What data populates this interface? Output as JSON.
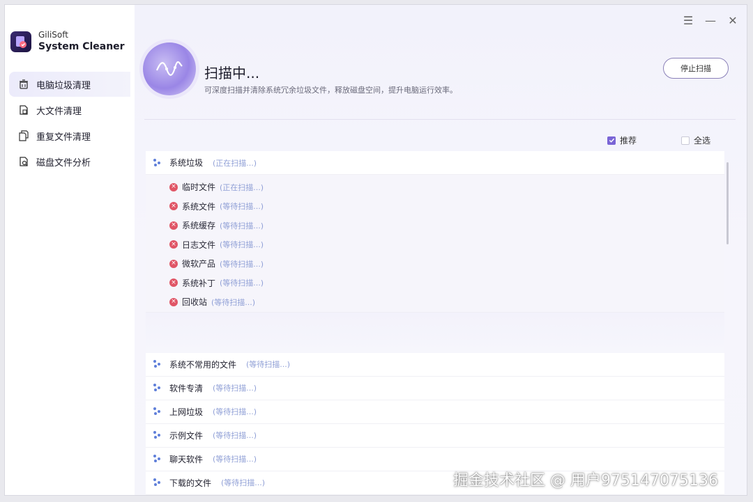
{
  "app": {
    "brand_small": "GiliSoft",
    "brand_name": "System Cleaner"
  },
  "sidebar": {
    "items": [
      {
        "label": "电脑垃圾清理",
        "icon": "trash-icon",
        "active": true
      },
      {
        "label": "大文件清理",
        "icon": "large-file-icon",
        "active": false
      },
      {
        "label": "重复文件清理",
        "icon": "duplicate-file-icon",
        "active": false
      },
      {
        "label": "磁盘文件分析",
        "icon": "disk-analysis-icon",
        "active": false
      }
    ]
  },
  "window_controls": {
    "menu": "☰",
    "minimize": "—",
    "close": "✕"
  },
  "header": {
    "title": "扫描中...",
    "subtitle": "可深度扫描并清除系统冗余垃圾文件，释放磁盘空间，提升电脑运行效率。",
    "stop_button": "停止扫描"
  },
  "filters": {
    "recommended": "推荐",
    "recommended_checked": true,
    "select_all": "全选",
    "select_all_checked": false
  },
  "groups": [
    {
      "label": "系统垃圾",
      "status": "(正在扫描...)",
      "children": [
        {
          "label": "临时文件",
          "status": "(正在扫描...)"
        },
        {
          "label": "系统文件",
          "status": "(等待扫描...)"
        },
        {
          "label": "系统缓存",
          "status": "(等待扫描...)"
        },
        {
          "label": "日志文件",
          "status": "(等待扫描...)"
        },
        {
          "label": "微软产品",
          "status": "(等待扫描...)"
        },
        {
          "label": "系统补丁",
          "status": "(等待扫描...)"
        },
        {
          "label": "回收站",
          "status": "(等待扫描...)"
        }
      ]
    },
    {
      "label": "系统不常用的文件",
      "status": "(等待扫描...)"
    },
    {
      "label": "软件专清",
      "status": "(等待扫描...)"
    },
    {
      "label": "上网垃圾",
      "status": "(等待扫描...)"
    },
    {
      "label": "示例文件",
      "status": "(等待扫描...)"
    },
    {
      "label": "聊天软件",
      "status": "(等待扫描...)"
    },
    {
      "label": "下载的文件",
      "status": "(等待扫描...)"
    }
  ],
  "watermark": "掘金技术社区 @ 用户975147075136",
  "colors": {
    "accent": "#7a65d6",
    "status_text": "#8f9fd6",
    "error": "#e05566"
  }
}
